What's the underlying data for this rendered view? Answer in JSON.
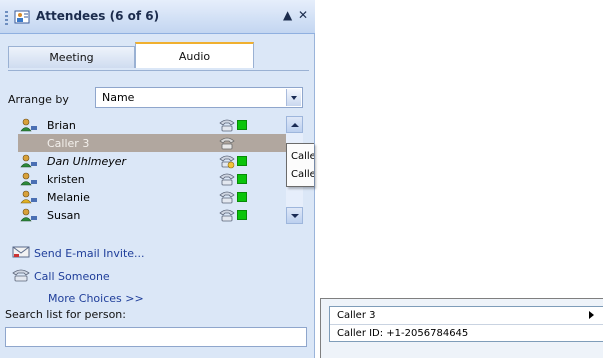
{
  "pane": {
    "title": "Attendees (6 of 6)",
    "collapse_glyph": "▲",
    "close_glyph": "✕",
    "tabs": [
      {
        "label": "Meeting",
        "active": false
      },
      {
        "label": "Audio",
        "active": true
      }
    ],
    "arrange": {
      "label": "Arrange by",
      "value": "Name"
    },
    "attendees": [
      {
        "name": "Brian",
        "status_color": "#0bc40b"
      },
      {
        "name": "Caller 3",
        "selected": true
      },
      {
        "name": "Dan Uhlmeyer",
        "status_color": "#0bc40b"
      },
      {
        "name": "kristen",
        "status_color": "#0bc40b"
      },
      {
        "name": "Melanie",
        "status_color": "#0bc40b"
      },
      {
        "name": "Susan",
        "status_color": "#0bc40b"
      }
    ],
    "actions": {
      "send_email": "Send E-mail Invite...",
      "call_someone": "Call Someone",
      "more_choices": "More Choices >>"
    },
    "search": {
      "label": "Search list for person:",
      "value": ""
    }
  },
  "mini_popup": {
    "items": [
      "Calle",
      "Calle"
    ]
  },
  "caller_menu": {
    "title": "Caller 3",
    "caller_id": "Caller ID: +1-2056784645"
  },
  "colors": {
    "pane_bg": "#dbe7f7",
    "selected_row": "#b1a79f",
    "status_green": "#0bc40b",
    "link": "#1f3e9a"
  },
  "icons": [
    "attendees-pane-icon",
    "person-icon",
    "phone-icon",
    "email-icon",
    "call-icon",
    "chevron-right-icon"
  ]
}
